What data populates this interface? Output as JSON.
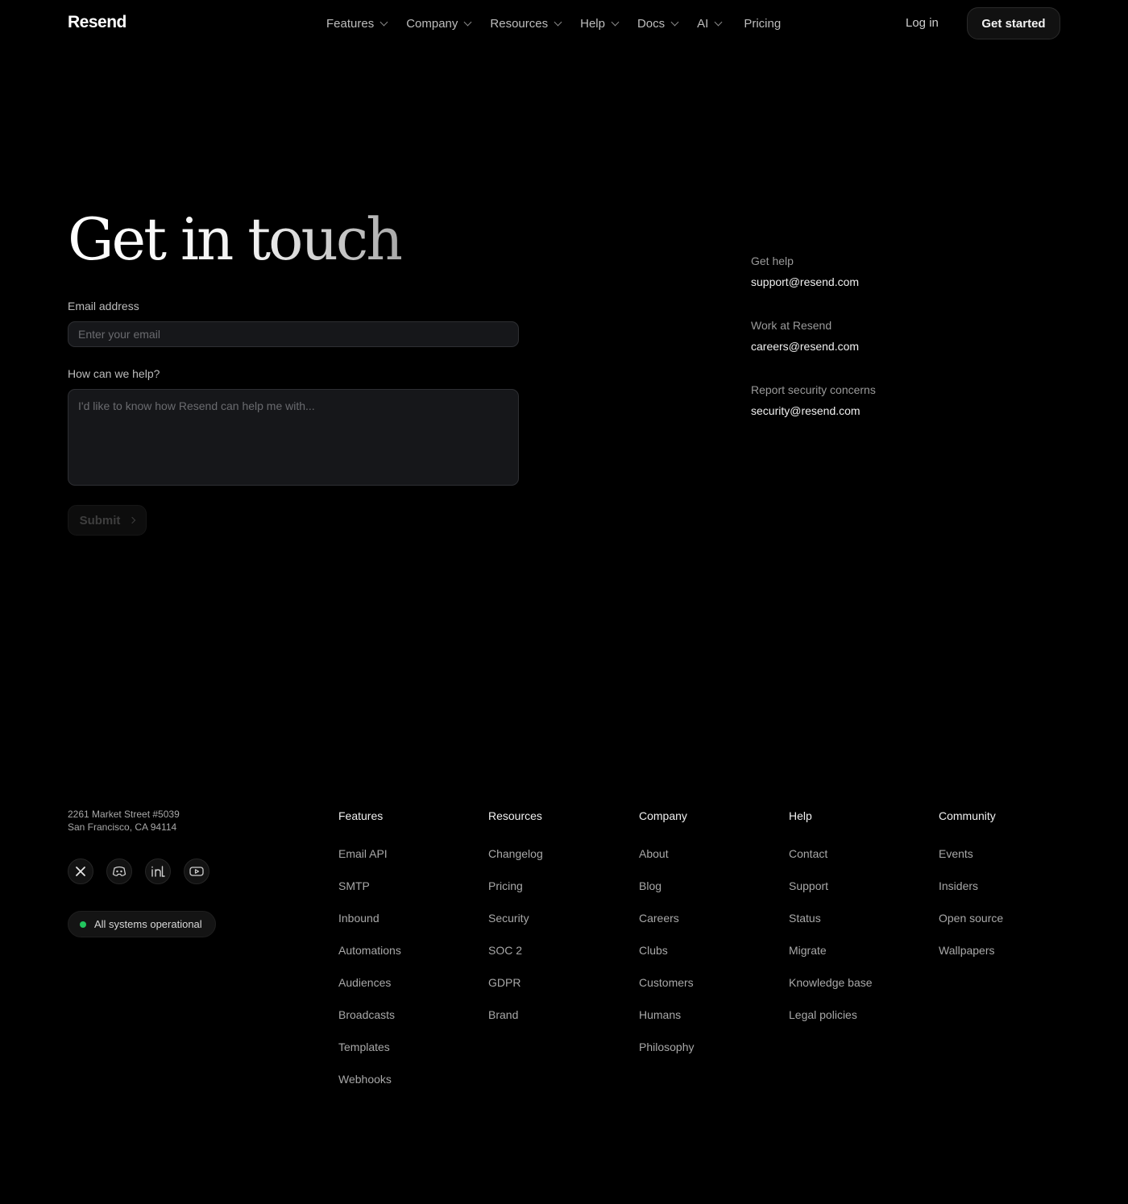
{
  "brand": {
    "logo_text": "Resend"
  },
  "nav": {
    "items": [
      {
        "label": "Features"
      },
      {
        "label": "Company"
      },
      {
        "label": "Resources"
      },
      {
        "label": "Help"
      },
      {
        "label": "Docs"
      },
      {
        "label": "AI"
      }
    ],
    "pricing": "Pricing",
    "login": "Log in",
    "get_started": "Get started"
  },
  "hero": {
    "title": "Get in touch"
  },
  "form": {
    "email_label": "Email address",
    "email_placeholder": "Enter your email",
    "email_value": "",
    "help_label": "How can we help?",
    "help_placeholder": "I'd like to know how Resend can help me with...",
    "help_value": "",
    "submit_label": "Submit"
  },
  "contacts": [
    {
      "label": "Get help",
      "email": "support@resend.com"
    },
    {
      "label": "Work at Resend",
      "email": "careers@resend.com"
    },
    {
      "label": "Report security concerns",
      "email": "security@resend.com"
    }
  ],
  "footer": {
    "address_line1": "2261 Market Street #5039",
    "address_line2": "San Francisco, CA 94114",
    "socials": [
      "x-icon",
      "discord-icon",
      "linkedin-icon",
      "youtube-icon"
    ],
    "status": {
      "text": "All systems operational",
      "color": "#22c55e"
    },
    "columns": [
      {
        "title": "Features",
        "links": [
          "Email API",
          "SMTP",
          "Inbound",
          "Automations",
          "Audiences",
          "Broadcasts",
          "Templates",
          "Webhooks"
        ]
      },
      {
        "title": "Resources",
        "links": [
          "Changelog",
          "Pricing",
          "Security",
          "SOC 2",
          "GDPR",
          "Brand"
        ]
      },
      {
        "title": "Company",
        "links": [
          "About",
          "Blog",
          "Careers",
          "Clubs",
          "Customers",
          "Humans",
          "Philosophy"
        ]
      },
      {
        "title": "Help",
        "links": [
          "Contact",
          "Support",
          "Status",
          "Migrate",
          "Knowledge base",
          "Legal policies"
        ]
      },
      {
        "title": "Community",
        "links": [
          "Events",
          "Insiders",
          "Open source",
          "Wallpapers"
        ]
      }
    ]
  }
}
